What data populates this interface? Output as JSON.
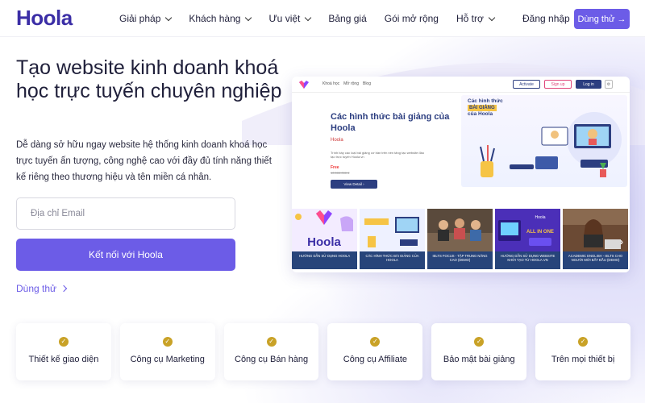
{
  "header": {
    "logo": "Hoola",
    "nav": [
      {
        "label": "Giải pháp",
        "dropdown": true
      },
      {
        "label": "Khách hàng",
        "dropdown": true
      },
      {
        "label": "Ưu việt",
        "dropdown": true
      },
      {
        "label": "Bảng giá",
        "dropdown": false
      },
      {
        "label": "Gói mở rộng",
        "dropdown": false
      },
      {
        "label": "Hỗ trợ",
        "dropdown": true
      }
    ],
    "login": "Đăng nhập",
    "try_button": "Dùng thử",
    "try_arrow": "→"
  },
  "hero": {
    "title": "Tạo website kinh doanh khoá học trực tuyến chuyên nghiệp",
    "description": "Dễ dàng sở hữu ngay website hệ thống kinh doanh khoá học trực tuyến ấn tượng, công nghệ cao với đầy đủ tính năng thiết kế riêng theo thương hiệu và tên miền cá nhân.",
    "email_placeholder": "Địa chỉ Email",
    "connect_button": "Kết nối với Hoola",
    "try_link": "Dùng thử"
  },
  "preview": {
    "nav": [
      "Khoá học",
      "Mở rộng",
      "Blog"
    ],
    "activate": "Activate",
    "signup": "Sign up",
    "login": "Log in",
    "title": "Các hình thức bài giảng của Hoola",
    "brand": "Hoola",
    "desc": "Trình bày các loại bài giảng cơ bản trên nền tảng tạo website đào tạo trực tuyến Hoola.vn",
    "price": "Free",
    "old_price": "10.000.000 đ",
    "detail_button": "View Detail",
    "art_title_1": "Các hình thức",
    "art_tag": "BÀI GIẢNG",
    "art_title_2": "của Hoola",
    "thumbnails": [
      {
        "caption": "HƯỚNG DẪN SỬ DỤNG HOOLA",
        "art": "Hoola"
      },
      {
        "caption": "CÁC HÌNH THỨC BÀI GIẢNG CỦA HOOLA",
        "art": "Các hình thức BÀI GIẢNG của Hoola"
      },
      {
        "caption": "IELTS FOCUS - TẬP TRUNG NÂNG CAO (DEMO)",
        "art": ""
      },
      {
        "caption": "HƯỚNG DẪN SỬ DỤNG WEBSITE KHỞI TẠO TỪ HOOLA.VN",
        "art": "ALL IN ONE"
      },
      {
        "caption": "ACADEMIC ENGLISH - IELTS CHO NGƯỜI MỚI BẮT ĐẦU (DEMO)",
        "art": ""
      }
    ]
  },
  "features": [
    {
      "label": "Thiết kế giao diện"
    },
    {
      "label": "Công cụ Marketing"
    },
    {
      "label": "Công cụ Bán hàng"
    },
    {
      "label": "Công cụ Affiliate"
    },
    {
      "label": "Bảo mật bài giảng"
    },
    {
      "label": "Trên mọi thiết bị"
    }
  ],
  "colors": {
    "brand": "#3b2ea6",
    "accent": "#6c5ce7",
    "check": "#c9a227",
    "preview_navy": "#27447a"
  }
}
